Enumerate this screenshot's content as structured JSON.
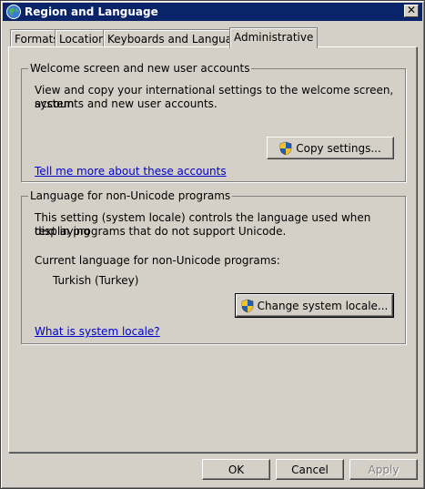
{
  "window": {
    "title": "Region and Language",
    "icon": "globe-icon"
  },
  "tabs": [
    {
      "label": "Formats"
    },
    {
      "label": "Location"
    },
    {
      "label": "Keyboards and Languages"
    },
    {
      "label": "Administrative",
      "active": true
    }
  ],
  "welcome": {
    "title": "Welcome screen and new user accounts",
    "description_line1": "View and copy your international settings to the welcome screen, system",
    "description_line2": "accounts and new user accounts.",
    "copy_button": "Copy settings...",
    "link": "Tell me more about these accounts"
  },
  "non_unicode": {
    "title": "Language for non-Unicode programs",
    "description_line1": "This setting (system locale) controls the language used when displaying",
    "description_line2": "text in programs that do not support Unicode.",
    "current_label": "Current language for non-Unicode programs:",
    "current_value": "Turkish (Turkey)",
    "change_button": "Change system locale...",
    "link": "What is system locale?"
  },
  "footer": {
    "ok": "OK",
    "cancel": "Cancel",
    "apply": "Apply",
    "apply_enabled": false
  },
  "icons": {
    "shield": "uac-shield-icon",
    "close": "close-icon"
  }
}
